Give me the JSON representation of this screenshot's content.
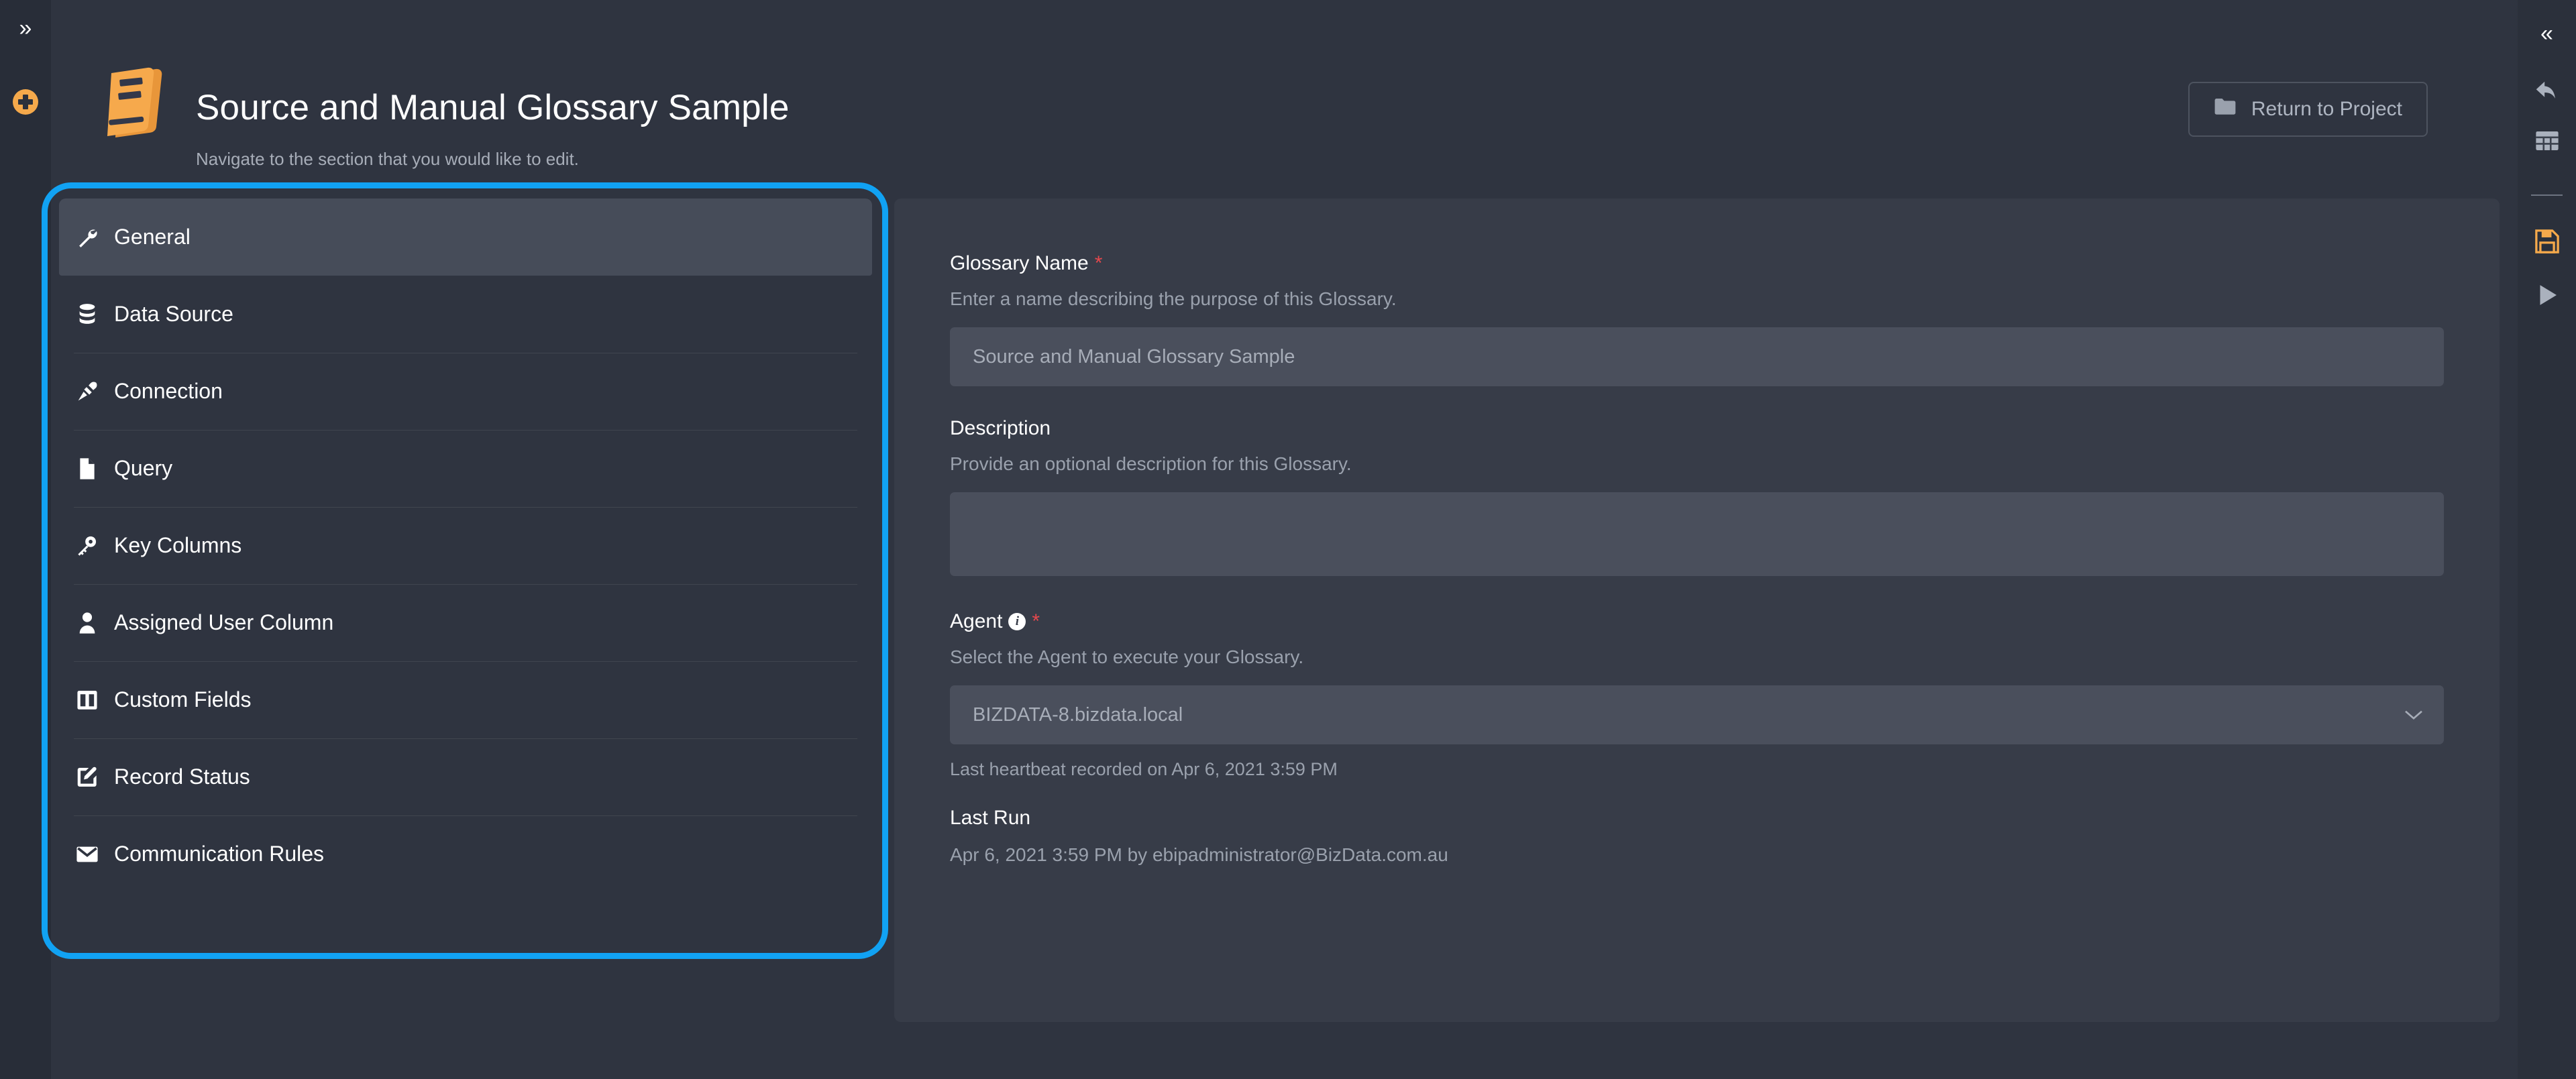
{
  "left_rail": {
    "expand_icon": "chevron-double-right-icon",
    "add_icon": "plus-circle-icon",
    "accent": "#f5a94b"
  },
  "right_rail": {
    "collapse_icon": "chevron-double-left-icon",
    "undo_icon": "undo-arrow-icon",
    "grid_icon": "table-grid-icon",
    "save_icon": "floppy-save-icon",
    "run_icon": "play-run-icon",
    "save_color": "#f5a94b"
  },
  "header": {
    "icon": "book-glossary-icon",
    "title": "Source and Manual Glossary Sample",
    "subtitle": "Navigate to the section that you would like to edit.",
    "return_button": {
      "label": "Return to Project",
      "icon": "folder-icon"
    }
  },
  "annotation": {
    "color": "#11a2f3"
  },
  "menu": {
    "items": [
      {
        "label": "General",
        "icon": "wrench-icon",
        "selected": true
      },
      {
        "label": "Data Source",
        "icon": "database-icon",
        "selected": false
      },
      {
        "label": "Connection",
        "icon": "plug-icon",
        "selected": false
      },
      {
        "label": "Query",
        "icon": "file-icon",
        "selected": false
      },
      {
        "label": "Key Columns",
        "icon": "key-icon",
        "selected": false
      },
      {
        "label": "Assigned User Column",
        "icon": "user-icon",
        "selected": false
      },
      {
        "label": "Custom Fields",
        "icon": "columns-icon",
        "selected": false
      },
      {
        "label": "Record Status",
        "icon": "pencil-square-icon",
        "selected": false
      },
      {
        "label": "Communication Rules",
        "icon": "envelope-icon",
        "selected": false
      }
    ]
  },
  "form": {
    "glossary_name": {
      "label": "Glossary Name",
      "required_mark": "*",
      "help": "Enter a name describing the purpose of this Glossary.",
      "value": "Source and Manual Glossary Sample",
      "placeholder": "Source and Manual Glossary Sample"
    },
    "description": {
      "label": "Description",
      "help": "Provide an optional description for this Glossary.",
      "value": "",
      "placeholder": ""
    },
    "agent": {
      "label": "Agent",
      "required_mark": "*",
      "info_icon": "info-icon",
      "info_glyph": "i",
      "help": "Select the Agent to execute your Glossary.",
      "value": "BIZDATA-8.bizdata.local",
      "chevron_icon": "chevron-down-icon",
      "heartbeat": "Last heartbeat recorded on Apr 6, 2021 3:59 PM"
    },
    "last_run": {
      "label": "Last Run",
      "value": "Apr 6, 2021 3:59 PM by ebipadministrator@BizData.com.au"
    }
  }
}
